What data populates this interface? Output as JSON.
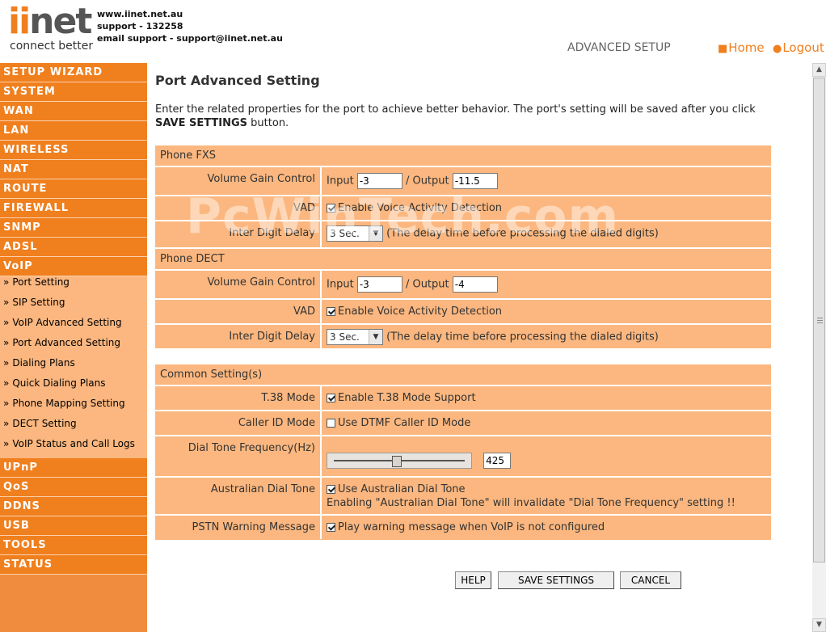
{
  "header": {
    "logo_text": "iinet",
    "tagline": "connect better",
    "website": "www.iinet.net.au",
    "support_phone": "support - 132258",
    "support_email": "email support - support@iinet.net.au",
    "section_title": "ADVANCED SETUP",
    "home_link": "Home",
    "logout_link": "Logout"
  },
  "sidebar": {
    "main_items_top": [
      "SETUP WIZARD",
      "SYSTEM",
      "WAN",
      "LAN",
      "WIRELESS",
      "NAT",
      "ROUTE",
      "FIREWALL",
      "SNMP",
      "ADSL",
      "VoIP"
    ],
    "voip_sub_items": [
      "Port Setting",
      "SIP Setting",
      "VoIP Advanced Setting",
      "Port Advanced Setting",
      "Dialing Plans",
      "Quick Dialing Plans",
      "Phone Mapping Setting",
      "DECT Setting",
      "VoIP Status and Call Logs"
    ],
    "main_items_bottom": [
      "UPnP",
      "QoS",
      "DDNS",
      "USB",
      "TOOLS",
      "STATUS"
    ]
  },
  "main": {
    "page_title": "Port Advanced Setting",
    "intro_text": "Enter the related properties for the port to achieve better behavior. The port's setting will be saved after you click",
    "intro_bold": "SAVE SETTINGS",
    "intro_end": " button.",
    "phone_fxs": {
      "heading": "Phone FXS",
      "volume_label": "Volume Gain Control",
      "input_label": "Input",
      "input_value": "-3",
      "output_label": "/ Output",
      "output_value": "-11.5",
      "vad_label": "VAD",
      "vad_text": "Enable Voice Activity Detection",
      "vad_checked": true,
      "delay_label": "Inter Digit Delay",
      "delay_value": "3 Sec.",
      "delay_note": "(The delay time before processing the dialed digits)"
    },
    "phone_dect": {
      "heading": "Phone DECT",
      "volume_label": "Volume Gain Control",
      "input_label": "Input",
      "input_value": "-3",
      "output_label": "/ Output",
      "output_value": "-4",
      "vad_label": "VAD",
      "vad_text": "Enable Voice Activity Detection",
      "vad_checked": true,
      "delay_label": "Inter Digit Delay",
      "delay_value": "3 Sec.",
      "delay_note": "(The delay time before processing the dialed digits)"
    },
    "common": {
      "heading": "Common Setting(s)",
      "t38_label": "T.38 Mode",
      "t38_text": "Enable T.38 Mode Support",
      "t38_checked": true,
      "callerid_label": "Caller ID Mode",
      "callerid_text": "Use DTMF Caller ID Mode",
      "callerid_checked": false,
      "dialtone_label": "Dial Tone Frequency(Hz)",
      "dialtone_value": "425",
      "au_label": "Australian Dial Tone",
      "au_text": "Use Australian Dial Tone",
      "au_checked": true,
      "au_note": "Enabling \"Australian Dial Tone\" will invalidate \"Dial Tone Frequency\" setting !!",
      "pstn_label": "PSTN Warning Message",
      "pstn_text": "Play warning message when VoIP is not configured",
      "pstn_checked": true
    },
    "buttons": {
      "help": "HELP",
      "save": "SAVE SETTINGS",
      "cancel": "CANCEL"
    }
  },
  "watermark": "PcWinTech.com",
  "colors": {
    "accent": "#f07f1e",
    "table_bg": "#fbb77f"
  }
}
